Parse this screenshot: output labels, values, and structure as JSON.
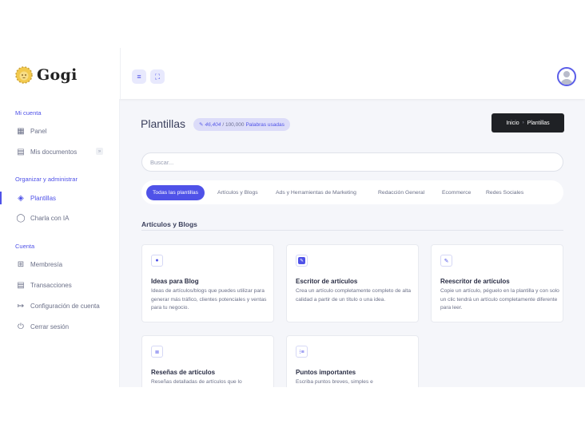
{
  "app": {
    "name": "Gogi"
  },
  "topbar": {
    "menu_icon": "menu-icon",
    "fullscreen_icon": "fullscreen-icon",
    "avatar_icon": "user-avatar"
  },
  "sidebar": {
    "sections": [
      {
        "label": "Mi cuenta",
        "items": [
          {
            "label": "Panel",
            "icon": "grid-icon"
          },
          {
            "label": "Mis documentos",
            "icon": "document-icon",
            "badge": "»"
          }
        ]
      },
      {
        "label": "Organizar y administrar",
        "items": [
          {
            "label": "Plantillas",
            "icon": "layers-icon",
            "active": true
          },
          {
            "label": "Charla con IA",
            "icon": "chat-icon"
          }
        ]
      },
      {
        "label": "Cuenta",
        "items": [
          {
            "label": "Membresía",
            "icon": "gift-icon"
          },
          {
            "label": "Transacciones",
            "icon": "receipt-icon"
          },
          {
            "label": "Configuración de cuenta",
            "icon": "login-icon"
          },
          {
            "label": "Cerrar sesión",
            "icon": "power-icon"
          }
        ]
      }
    ]
  },
  "header": {
    "title": "Plantillas",
    "usage": {
      "used": "46,404",
      "total": "/ 100,000",
      "unit": "Palabras usadas"
    },
    "breadcrumb": [
      "Inicio",
      "Plantillas"
    ]
  },
  "search": {
    "placeholder": "Buscar..."
  },
  "tabs": [
    "Todas las plantillas",
    "Artículos y Blogs",
    "Ads y Herramientas de Marketing",
    "Redacción General",
    "Ecommerce",
    "Redes Sociales"
  ],
  "section": {
    "title": "Artículos y Blogs"
  },
  "cards": [
    {
      "title": "Ideas para Blog",
      "description": "Ideas de artículos/blogs que puedes utilizar para generar más tráfico, clientes potenciales y ventas para tu negocio.",
      "icon": "chat-bubble-icon"
    },
    {
      "title": "Escritor de artículos",
      "description": "Crea un artículo completamente completo de alta calidad a partir de un título o una idea.",
      "icon": "pencil-square-icon"
    },
    {
      "title": "Reescritor de artículos",
      "description": "Copie un artículo, péguelo en la plantilla y con solo un clic tendrá un artículo completamente diferente para leer.",
      "icon": "edit-icon"
    },
    {
      "title": "Reseñas de artículos",
      "description": "Reseñas detalladas de artículos que lo",
      "icon": "list-icon"
    },
    {
      "title": "Puntos importantes",
      "description": "Escriba puntos breves, simples e",
      "icon": "list-bullets-icon"
    }
  ],
  "colors": {
    "accent": "#4f52e8",
    "dark": "#1f2125",
    "bg": "#f5f6fa"
  }
}
